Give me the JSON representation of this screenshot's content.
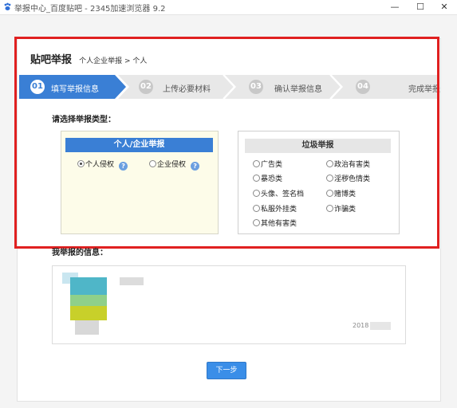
{
  "window": {
    "title": "举报中心_百度贴吧 - 2345加速浏览器 9.2",
    "minimize": "—",
    "maximize": "☐",
    "close": "✕"
  },
  "heading": {
    "main": "贴吧举报",
    "crumb": "个人企业举报 > 个人"
  },
  "steps": [
    {
      "num": "01",
      "label": "填写举报信息",
      "active": true
    },
    {
      "num": "02",
      "label": "上传必要材料",
      "active": false
    },
    {
      "num": "03",
      "label": "确认举报信息",
      "active": false
    },
    {
      "num": "04",
      "label": "完成举报",
      "active": false
    }
  ],
  "prompt": "请选择举报类型：",
  "personal": {
    "header": "个人/企业举报",
    "options": [
      {
        "label": "个人侵权",
        "selected": true
      },
      {
        "label": "企业侵权",
        "selected": false
      }
    ],
    "help_glyph": "?"
  },
  "spam": {
    "header": "垃圾举报",
    "options": [
      "广告类",
      "政治有害类",
      "暴恐类",
      "淫秽色情类",
      "头像、签名档",
      "赌博类",
      "私服外挂类",
      "诈骗类",
      "其他有害类"
    ]
  },
  "my_info": {
    "label": "我举报的信息：",
    "date_text": "2018"
  },
  "next_button": "下一步",
  "colors": {
    "accent": "#3a7fd5",
    "highlight": "#e02020",
    "step_inactive": "#e8e8e8"
  }
}
